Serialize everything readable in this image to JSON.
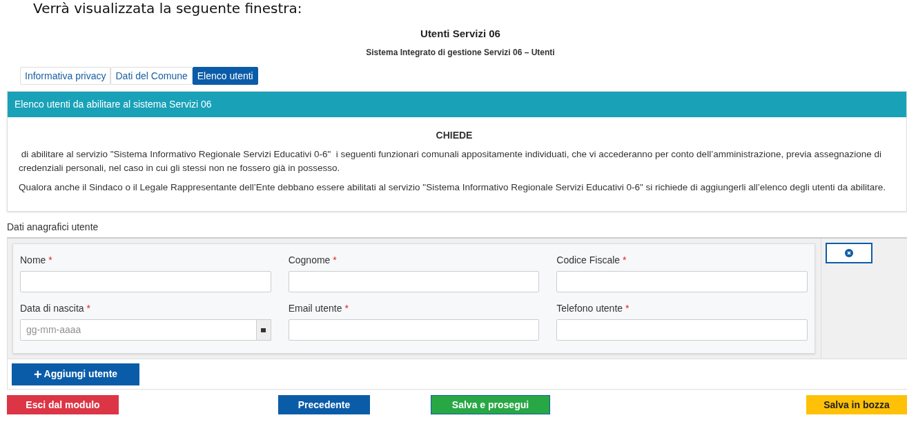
{
  "intro_text": "Verrà visualizzata la seguente finestra:",
  "header": {
    "title": "Utenti Servizi 06",
    "subtitle": "Sistema Integrato di gestione Servizi 06 – Utenti"
  },
  "tabs": [
    {
      "label": "Informativa privacy",
      "selected": false
    },
    {
      "label": "Dati del Comune",
      "selected": false
    },
    {
      "label": "Elenco utenti",
      "selected": true
    }
  ],
  "panel": {
    "title": "Elenco utenti da abilitare al sistema Servizi 06",
    "heading": "CHIEDE",
    "paragraphs": [
      " di abilitare al servizio \"Sistema Informativo Regionale Servizi Educativi 0-6\"  i seguenti funzionari comunali appositamente individuati, che vi accederanno per conto dell’amministrazione, previa assegnazione di credenziali personali, nel caso in cui gli stessi non ne fossero già in possesso.",
      "Qualora anche il Sindaco o il Legale Rappresentante dell’Ente debbano essere abilitati al servizio \"Sistema Informativo Regionale Servizi Educativi 0-6\" si richiede di aggiungerli all’elenco degli utenti da abilitare."
    ]
  },
  "section_label": "Dati anagrafici utente",
  "fields": [
    {
      "label": "Nome",
      "required_mark": "*",
      "kind": "text"
    },
    {
      "label": "Cognome",
      "required_mark": "*",
      "kind": "text"
    },
    {
      "label": "Codice Fiscale",
      "required_mark": "*",
      "kind": "text"
    },
    {
      "label": "Data di nascita",
      "required_mark": "*",
      "kind": "date",
      "placeholder": "gg-mm-aaaa"
    },
    {
      "label": "Email utente",
      "required_mark": "*",
      "kind": "text"
    },
    {
      "label": "Telefono utente",
      "required_mark": "*",
      "kind": "text"
    }
  ],
  "add_button": {
    "icon": "+",
    "label": "Aggiungi utente"
  },
  "footer_buttons": [
    {
      "label": "Esci dal modulo",
      "kind": "danger"
    },
    {
      "label": "Precedente",
      "kind": "primary"
    },
    {
      "label": "Salva e prosegui",
      "kind": "success"
    },
    {
      "label": "Salva in bozza",
      "kind": "warning"
    }
  ]
}
